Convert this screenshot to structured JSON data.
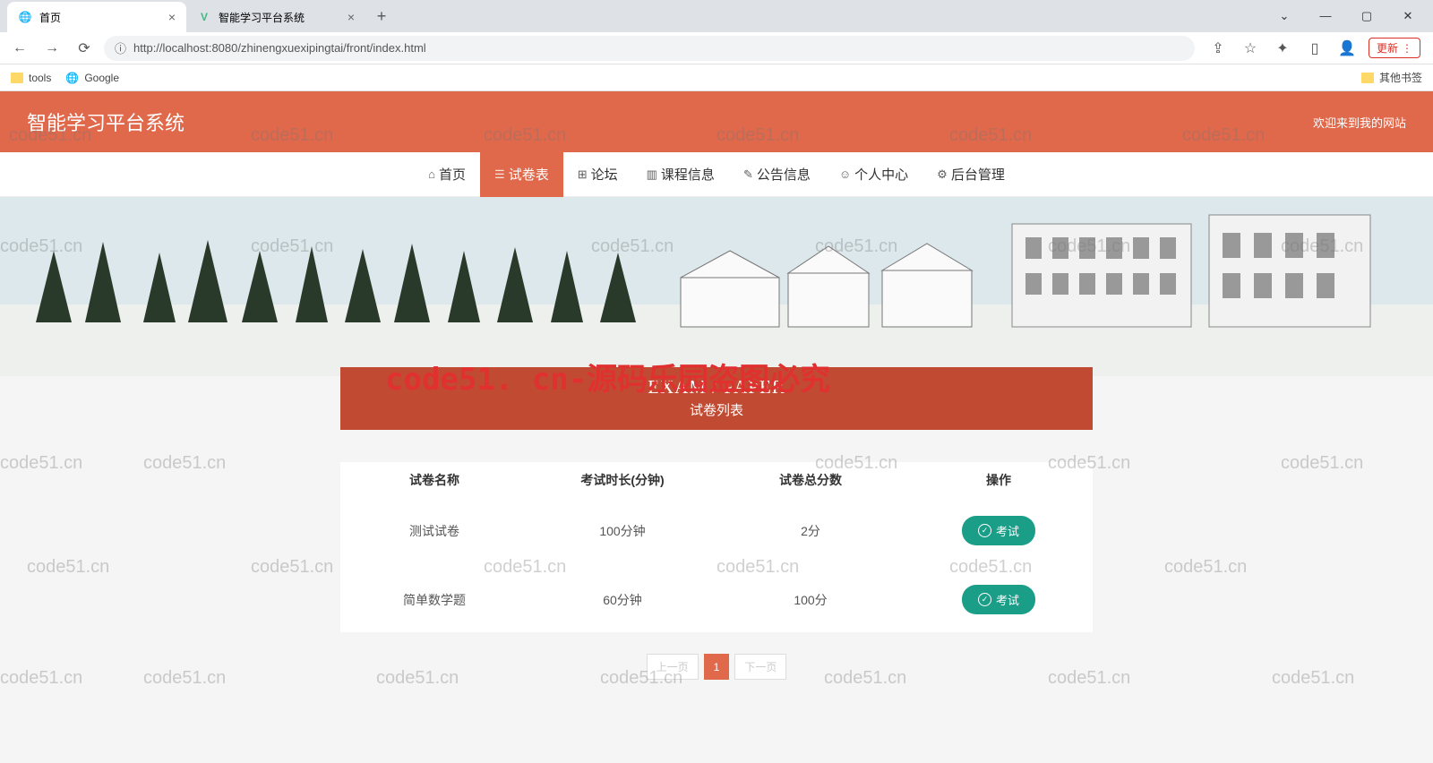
{
  "browser": {
    "tabs": [
      {
        "title": "首页",
        "favicon": "globe"
      },
      {
        "title": "智能学习平台系统",
        "favicon": "vue"
      }
    ],
    "url": "http://localhost:8080/zhinengxuexipingtai/front/index.html",
    "update_label": "更新",
    "bookmarks": [
      {
        "label": "tools"
      },
      {
        "label": "Google"
      }
    ],
    "other_bookmarks": "其他书签"
  },
  "header": {
    "title": "智能学习平台系统",
    "welcome": "欢迎来到我的网站"
  },
  "nav": [
    {
      "icon": "⌂",
      "label": "首页"
    },
    {
      "icon": "☰",
      "label": "试卷表",
      "active": true
    },
    {
      "icon": "⊞",
      "label": "论坛"
    },
    {
      "icon": "▥",
      "label": "课程信息"
    },
    {
      "icon": "✎",
      "label": "公告信息"
    },
    {
      "icon": "☺",
      "label": "个人中心"
    },
    {
      "icon": "⚙",
      "label": "后台管理"
    }
  ],
  "section": {
    "en": "EXAM / PAPER",
    "cn": "试卷列表"
  },
  "table": {
    "headers": [
      "试卷名称",
      "考试时长(分钟)",
      "试卷总分数",
      "操作"
    ],
    "rows": [
      {
        "name": "测试试卷",
        "duration": "100分钟",
        "score": "2分",
        "action": "考试"
      },
      {
        "name": "简单数学题",
        "duration": "60分钟",
        "score": "100分",
        "action": "考试"
      }
    ]
  },
  "pagination": {
    "prev": "上一页",
    "pages": [
      "1"
    ],
    "next": "下一页"
  },
  "watermark_main": "code51. cn-源码乐园盗图必究",
  "watermark_cell": "code51.cn"
}
